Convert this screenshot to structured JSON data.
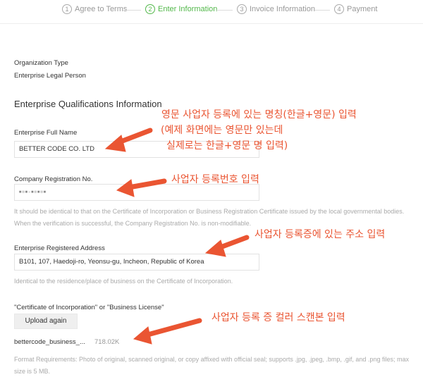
{
  "stepper": {
    "steps": [
      {
        "num": "1",
        "label": "Agree to Terms"
      },
      {
        "num": "2",
        "label": "Enter Information"
      },
      {
        "num": "3",
        "label": "Invoice Information"
      },
      {
        "num": "4",
        "label": "Payment"
      }
    ],
    "active_index": 1
  },
  "org": {
    "type_label": "Organization Type",
    "type_value": "Enterprise Legal Person"
  },
  "qualifications": {
    "title": "Enterprise Qualifications Information",
    "full_name_label": "Enterprise Full Name",
    "full_name_value": "BETTER CODE CO. LTD",
    "reg_no_label": "Company Registration No.",
    "reg_no_value": "▪▫▪·▪▫▪▫▪",
    "reg_no_hint": "It should be identical to that on the Certificate of Incorporation or Business Registration Certificate issued by the local governmental bodies. When the verification is successful, the Company Registration No. is non-modifiable.",
    "address_label": "Enterprise Registered Address",
    "address_value": "B101, 107, Haedoji-ro, Yeonsu-gu, Incheon, Republic of Korea",
    "address_hint": "Identical to the residence/place of business on the Certificate of Incorporation.",
    "license_label": "\"Certificate of Incorporation\" or \"Business License\"",
    "upload_button": "Upload again",
    "file_name": "bettercode_business_...",
    "file_size": "718.02K",
    "format_hint": "Format Requirements: Photo of original, scanned original, or copy affixed with official seal; supports .jpg, .jpeg, .bmp, .gif, and .png files; max size is 5 MB."
  },
  "annotations": {
    "name_line1": "영문 사업자 등록에 있는 명칭(한글+영문) 입력",
    "name_line2": "(예제 화면에는 영문만 있는데",
    "name_line3": "실제로는 한글+영문 명 입력)",
    "reg_no": "사업자 등록번호 입력",
    "address": "사업자 등록증에 있는 주소 입력",
    "license": "사업자 등록 증 컬러 스캔본 입력",
    "arrow_color": "#ea5532"
  }
}
